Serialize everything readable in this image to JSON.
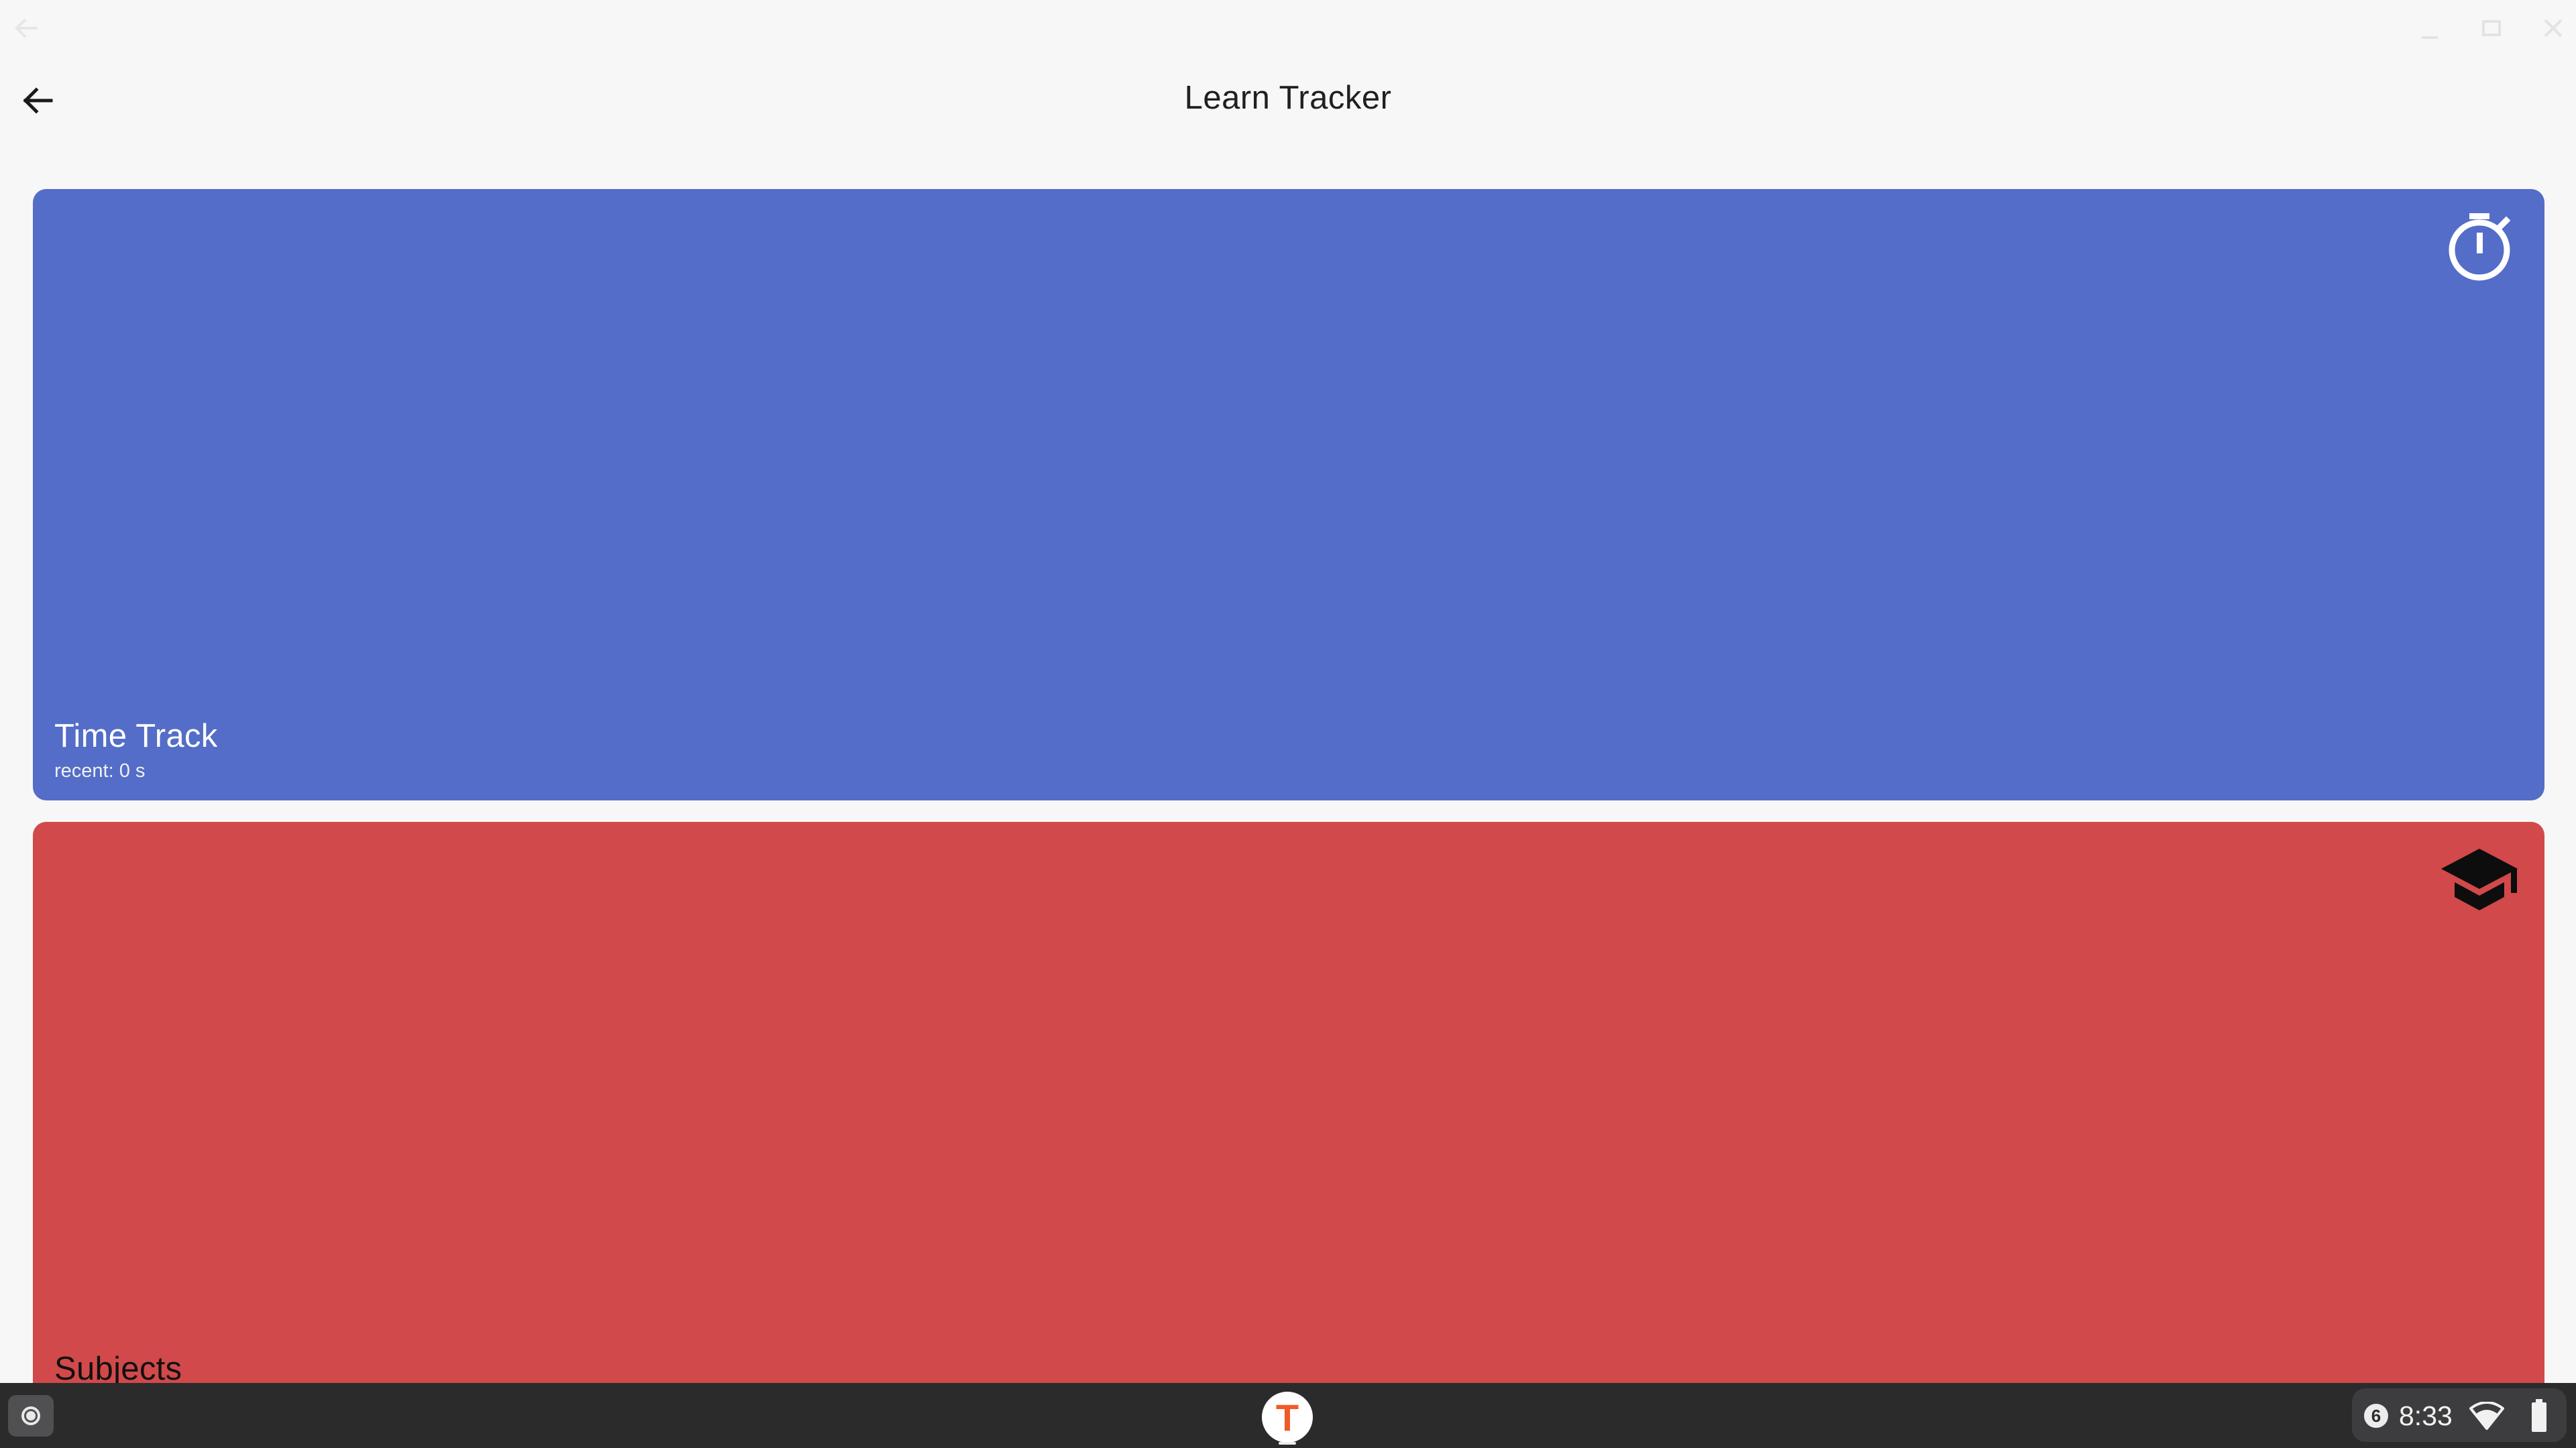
{
  "app": {
    "title": "Learn Tracker"
  },
  "cards": [
    {
      "title": "Time Track",
      "subtitle": "recent: 0 s",
      "color": "#536dc8",
      "text_color": "#ffffff",
      "icon": "stopwatch-icon"
    },
    {
      "title": "Subjects",
      "subtitle": "",
      "color": "#d1494a",
      "text_color": "#111111",
      "icon": "school-icon"
    }
  ],
  "shelf": {
    "pinned_app_letter": "T",
    "notification_count": "6",
    "time": "8:33"
  },
  "colors": {
    "background": "#f7f7f7",
    "shelf": "#2b2b2c",
    "app_accent": "#f05a28"
  }
}
